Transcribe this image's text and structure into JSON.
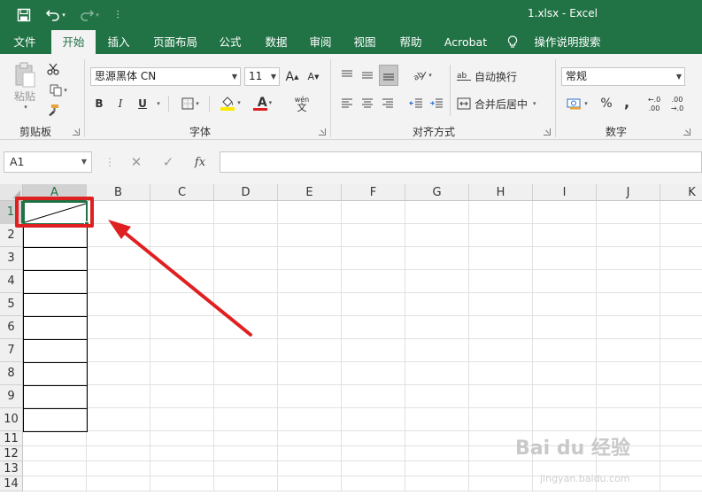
{
  "window": {
    "title": "1.xlsx  -  Excel"
  },
  "quick_access": {
    "more_label": "⫶"
  },
  "tabs": [
    {
      "label": "文件"
    },
    {
      "label": "开始"
    },
    {
      "label": "插入"
    },
    {
      "label": "页面布局"
    },
    {
      "label": "公式"
    },
    {
      "label": "数据"
    },
    {
      "label": "审阅"
    },
    {
      "label": "视图"
    },
    {
      "label": "帮助"
    },
    {
      "label": "Acrobat"
    },
    {
      "label": "操作说明搜索"
    }
  ],
  "ribbon": {
    "clipboard": {
      "label": "剪贴板",
      "paste_label": "粘贴"
    },
    "font": {
      "label": "字体",
      "font_name": "思源黑体 CN",
      "font_size": "11",
      "bold": "B",
      "italic": "I",
      "underline": "U",
      "grow": "A",
      "shrink": "A",
      "font_color": "A",
      "phonetic_top": "wén",
      "phonetic_bottom": "文"
    },
    "alignment": {
      "label": "对齐方式",
      "wrap_text": "自动换行",
      "merge_center": "合并后居中",
      "wrap_icon": "ab"
    },
    "number": {
      "label": "数字",
      "format": "常规",
      "percent": "%",
      "comma": ",",
      "inc_decimal_top": "←.0",
      "inc_decimal_bottom": ".00",
      "dec_decimal_top": ".00",
      "dec_decimal_bottom": "→.0"
    }
  },
  "formula_bar": {
    "name_box": "A1",
    "cancel": "✕",
    "enter": "✓",
    "fx": "fx"
  },
  "columns": [
    "A",
    "B",
    "C",
    "D",
    "E",
    "F",
    "G",
    "H",
    "I",
    "J",
    "K"
  ],
  "rows": [
    "1",
    "2",
    "3",
    "4",
    "5",
    "6",
    "7",
    "8",
    "9",
    "10",
    "11",
    "12",
    "13",
    "14"
  ],
  "selected_cell": "A1",
  "watermark": {
    "main": "Bai du 经验",
    "sub": "jingyan.baidu.com"
  },
  "colors": {
    "accent": "#217346",
    "annotation": "#e02020"
  }
}
